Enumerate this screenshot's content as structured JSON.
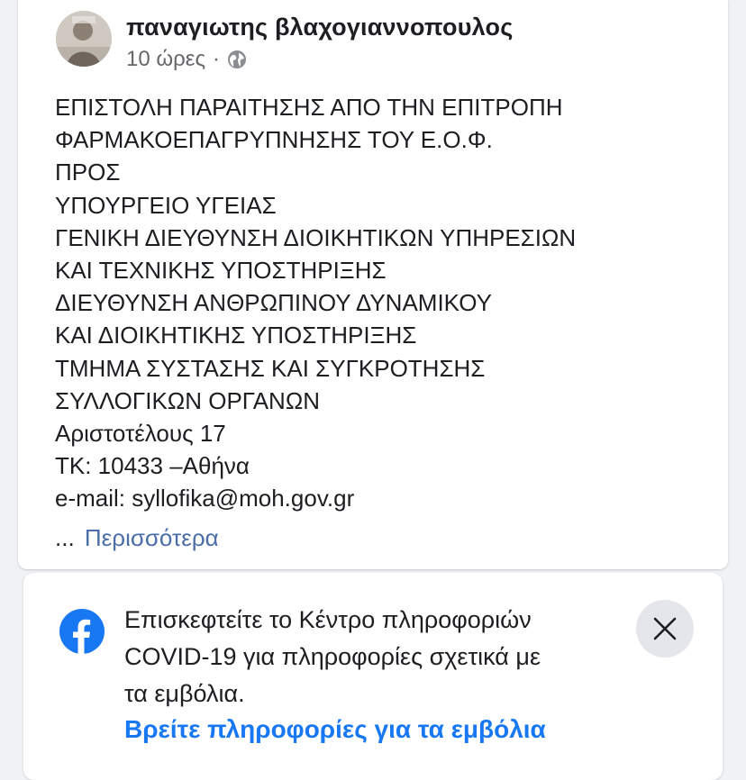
{
  "post": {
    "author": "παναγιωτης βλαχογιαννοπουλος",
    "time": "10 ώρες",
    "separator": "·",
    "audience_icon": "globe-icon",
    "text_lines": [
      "ΕΠΙΣΤΟΛΗ ΠΑΡΑΙΤΗΣΗΣ ΑΠΟ ΤΗΝ ΕΠΙΤΡΟΠΗ",
      "ΦΑΡΜΑΚΟΕΠΑΓΡΥΠΝΗΣΗΣ ΤΟΥ Ε.Ο.Φ.",
      "ΠΡΟΣ",
      "ΥΠΟΥΡΓΕΙΟ ΥΓΕΙΑΣ",
      "ΓΕΝΙΚΗ ΔΙΕΥΘΥΝΣΗ ΔΙΟΙΚΗΤΙΚΩΝ ΥΠΗΡΕΣΙΩΝ",
      "ΚΑΙ ΤΕΧΝΙΚΗΣ ΥΠΟΣΤΗΡΙΞΗΣ",
      "ΔΙΕΥΘΥΝΣΗ ΑΝΘΡΩΠΙΝΟΥ ΔΥΝΑΜΙΚΟΥ",
      "ΚΑΙ ΔΙΟΙΚΗΤΙΚΗΣ ΥΠΟΣΤΗΡΙΞΗΣ",
      "ΤΜΗΜΑ ΣΥΣΤΑΣΗΣ ΚΑΙ ΣΥΓΚΡΟΤΗΣΗΣ",
      "ΣΥΛΛΟΓΙΚΩΝ ΟΡΓΑΝΩΝ",
      "Αριστοτέλους 17",
      "ΤΚ: 10433 –Αθήνα",
      "e-mail: syllofika@moh.gov.gr"
    ],
    "ellipsis": "...",
    "more_label": "Περισσότερα"
  },
  "covid_banner": {
    "logo_icon": "facebook-logo-icon",
    "text_lines": [
      "Επισκεφτείτε το Κέντρο πληροφοριών",
      "COVID-19 για πληροφορίες σχετικά με",
      "τα εμβόλια."
    ],
    "link_label": "Βρείτε πληροφορίες για τα εμβόλια",
    "close_icon": "close-icon"
  },
  "colors": {
    "link_blue": "#1877f2",
    "more_link": "#4b6ea8",
    "secondary_text": "#65676b",
    "background": "#f0f2f5"
  }
}
